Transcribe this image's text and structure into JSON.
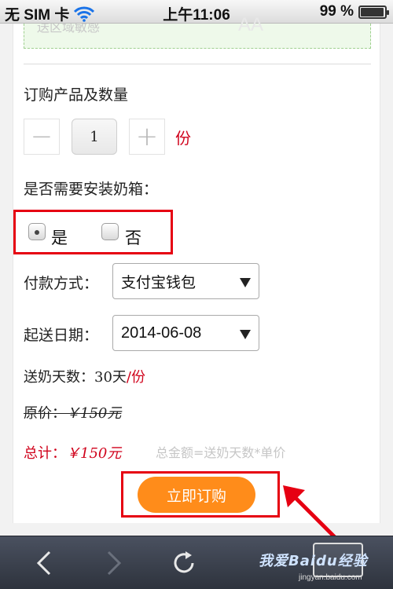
{
  "status_bar": {
    "carrier": "无 SIM 卡",
    "time": "上午11:06",
    "battery": "99 %"
  },
  "form": {
    "textarea_fragment": "送区域敏感",
    "product_qty_label": "订购产品及数量",
    "quantity": "1",
    "minus_symbol": "−",
    "plus_symbol": "+",
    "unit": "份",
    "install_label": "是否需要安装奶箱：",
    "install_options": [
      {
        "label": "是",
        "checked": true
      },
      {
        "label": "否",
        "checked": false
      }
    ],
    "payment_label": "付款方式：",
    "payment_value": "支付宝钱包",
    "date_label": "起送日期：",
    "date_value": "2014-06-08",
    "days_label": "送奶天数：",
    "days_value": "30天",
    "days_unit": "/份",
    "original_price_label": "原价：",
    "original_price_value": "￥150元",
    "total_label": "总计：",
    "total_value": "￥150元",
    "total_note": "总金额=送奶天数*单价",
    "buy_button": "立即订购"
  },
  "watermark": {
    "text": "我爱Baidu经验",
    "url": "jingyan.baidu.com"
  },
  "colors": {
    "accent_orange": "#ff8c1a",
    "price_red": "#d0021b",
    "annotation_red": "#e60012"
  }
}
